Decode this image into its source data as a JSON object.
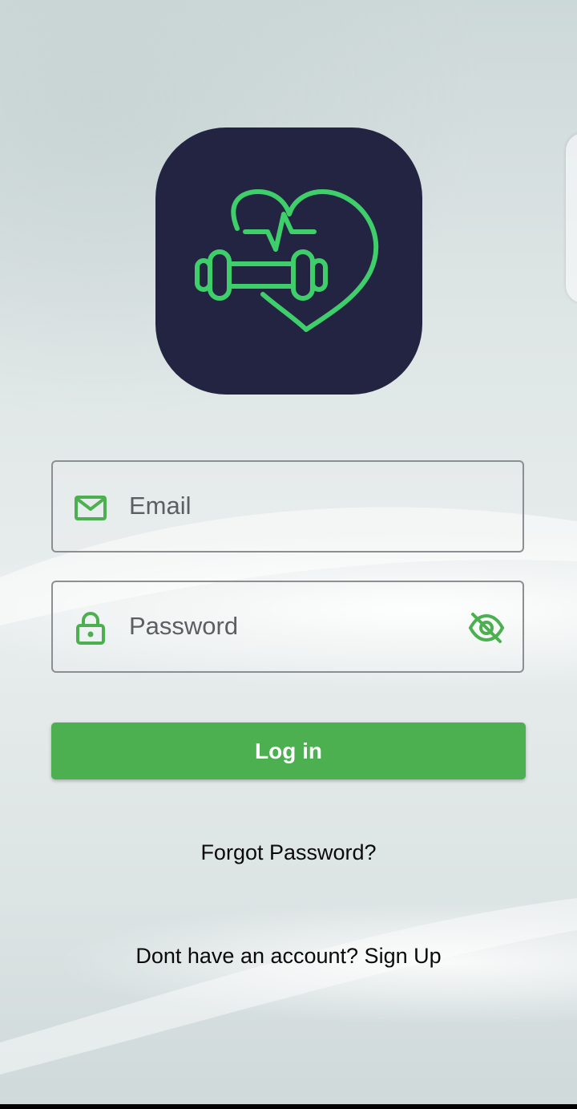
{
  "colors": {
    "accent": "#4caf50",
    "logo_bg": "#222442",
    "logo_line": "#3fcf6a",
    "icon_green": "#4caf50"
  },
  "logo": {
    "icon": "heart-dumbbell-pulse-icon"
  },
  "form": {
    "email": {
      "icon": "mail-icon",
      "placeholder": "Email",
      "value": ""
    },
    "password": {
      "icon": "lock-icon",
      "placeholder": "Password",
      "value": "",
      "toggle_icon": "eye-off-icon"
    },
    "login_label": "Log in"
  },
  "links": {
    "forgot_password": "Forgot Password?",
    "signup": "Dont have an account? Sign Up"
  }
}
